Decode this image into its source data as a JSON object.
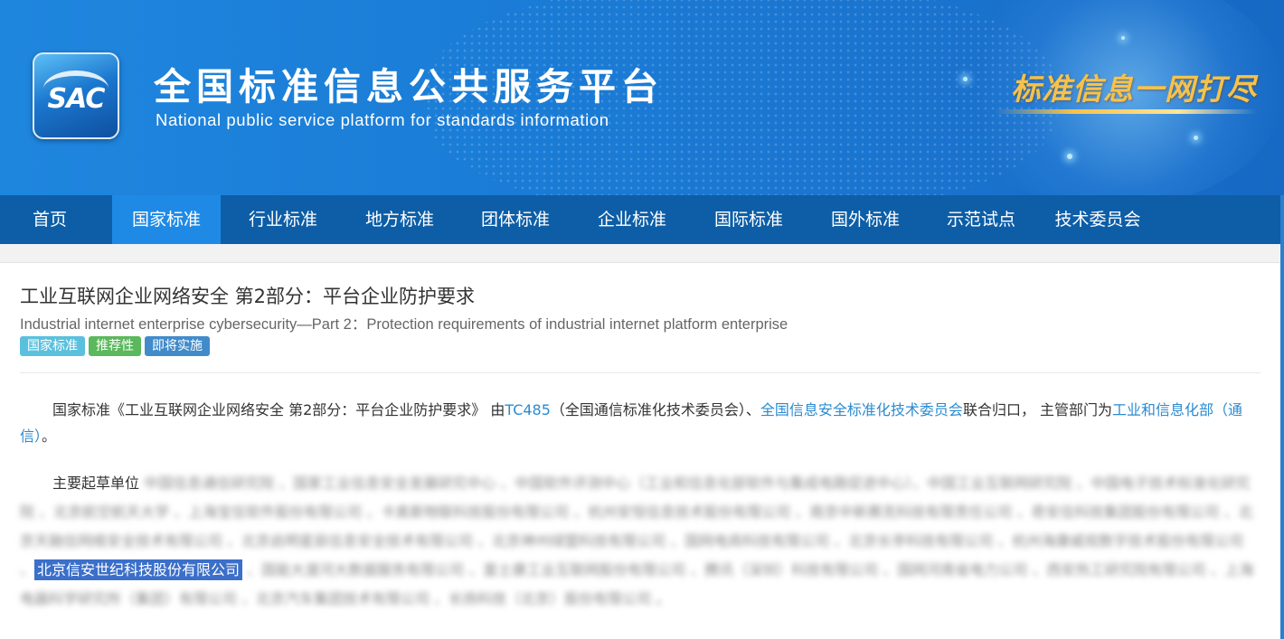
{
  "header": {
    "logo_text": "SAC",
    "site_title": "全国标准信息公共服务平台",
    "site_subtitle": "National public service platform  for standards information",
    "slogan": "标准信息一网打尽"
  },
  "nav": {
    "items": [
      {
        "label": "首页",
        "active": false
      },
      {
        "label": "国家标准",
        "active": true
      },
      {
        "label": "行业标准",
        "active": false
      },
      {
        "label": "地方标准",
        "active": false
      },
      {
        "label": "团体标准",
        "active": false
      },
      {
        "label": "企业标准",
        "active": false
      },
      {
        "label": "国际标准",
        "active": false
      },
      {
        "label": "国外标准",
        "active": false
      },
      {
        "label": "示范试点",
        "active": false
      },
      {
        "label": "技术委员会",
        "active": false
      }
    ]
  },
  "standard": {
    "title_cn": "工业互联网企业网络安全 第2部分：平台企业防护要求",
    "title_en": "Industrial internet enterprise cybersecurity—Part 2：Protection requirements of industrial internet platform enterprise",
    "tags": [
      "国家标准",
      "推荐性",
      "即将实施"
    ]
  },
  "description": {
    "prefix": "国家标准《工业互联网企业网络安全 第2部分：平台企业防护要求》 由",
    "tc_link": "TC485",
    "tc_name": "（全国通信标准化技术委员会）、",
    "committee_link": "全国信息安全标准化技术委员会",
    "middle": "联合归口， 主管部门为",
    "dept_link": "工业和信息化部（通信）",
    "suffix": "。"
  },
  "drafters": {
    "label": "主要起草单位",
    "blurred_before": "中国信息通信研究院 、国家工业信息安全发展研究中心 、中国软件评测中心（工业和信息化部软件与集成电路促进中心）、中国工业互联网研究院 、中国电子技术标准化研究院 、北京航空航天大学 、上海宝信软件股份有限公司 、卡奥斯物联科技股份有限公司 、杭州安恒信息技术股份有限公司 、南京中新赛克科技有限责任公司 、奇安信科技集团股份有限公司 、北京天融信网络安全技术有限公司 、北京启明星辰信息安全技术有限公司 、北京神州绿盟科技有限公司 、国网电商科技有限公司 、北京长亭科技有限公司 、杭州海康威视数字技术股份有限公司 、",
    "highlighted": "北京信安世纪科技股份有限公司",
    "blurred_after": " 、国能大渡河大数据服务有限公司 、富士康工业互联网股份有限公司 、腾讯（深圳）科技有限公司 、国网河南省电力公司 、西安热工研究院有限公司 、上海电器科学研究所（集团）有限公司 、北京汽车集团技术有限公司 、长扬科技（北京）股份有限公司 。"
  }
}
